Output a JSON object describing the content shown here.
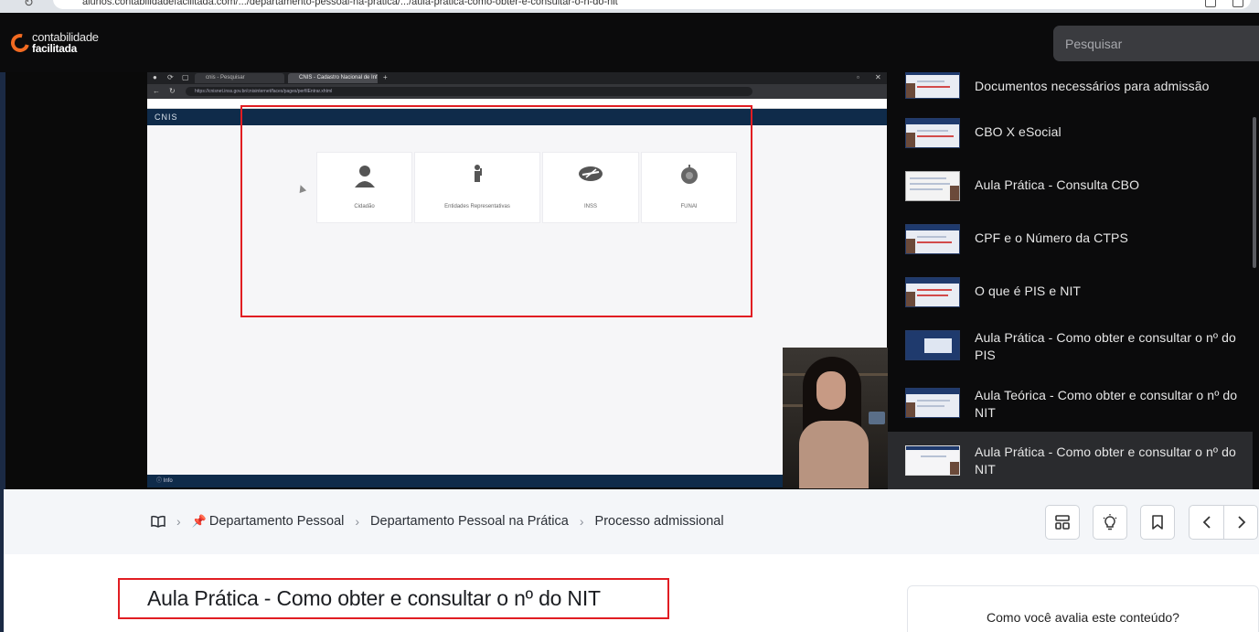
{
  "browser": {
    "url": "alunos.contabilidadefacilitada.com/.../departamento-pessoal-na-pratica/.../aula-pratica-como-obter-e-consultar-o-n-do-nit"
  },
  "header": {
    "logo_line1": "contabilidade",
    "logo_line2": "facilitada",
    "search_placeholder": "Pesquisar"
  },
  "video": {
    "tabs": [
      "cnis - Pesquisar",
      "CNIS - Cadastro Nacional de Inf..."
    ],
    "address": "https://cnisnet.inss.gov.br/cnisinternet/faces/pages/perfilEntrar.xhtml",
    "site_name": "CNIS",
    "cards": [
      {
        "label": "Cidadão",
        "icon": "person-icon"
      },
      {
        "label": "Entidades Representativas",
        "icon": "representative-icon"
      },
      {
        "label": "INSS",
        "icon": "inss-logo-icon"
      },
      {
        "label": "FUNAI",
        "icon": "funai-emblem-icon"
      }
    ],
    "footer": "Info"
  },
  "playlist": {
    "items": [
      {
        "title": "Documentos necessários para admissão"
      },
      {
        "title": "CBO X eSocial"
      },
      {
        "title": "Aula Prática - Consulta CBO"
      },
      {
        "title": "CPF e o Número da CTPS"
      },
      {
        "title": "O que é PIS e NIT"
      },
      {
        "title": "Aula Prática - Como obter e consultar o nº do PIS"
      },
      {
        "title": "Aula Teórica - Como obter e consultar o nº do NIT"
      },
      {
        "title": "Aula Prática - Como obter e consultar o nº do NIT",
        "active": true
      }
    ]
  },
  "breadcrumb": {
    "items": [
      "Departamento Pessoal",
      "Departamento Pessoal na Prática",
      "Processo admissional"
    ]
  },
  "lesson": {
    "title": "Aula Prática - Como obter e consultar o nº do NIT"
  },
  "rating": {
    "question": "Como você avalia este conteúdo?"
  },
  "colors": {
    "accent_orange": "#f26a21",
    "highlight_red": "#e11d22",
    "cnis_navy": "#0f2b4a",
    "header_bg": "#0b0b0c"
  }
}
